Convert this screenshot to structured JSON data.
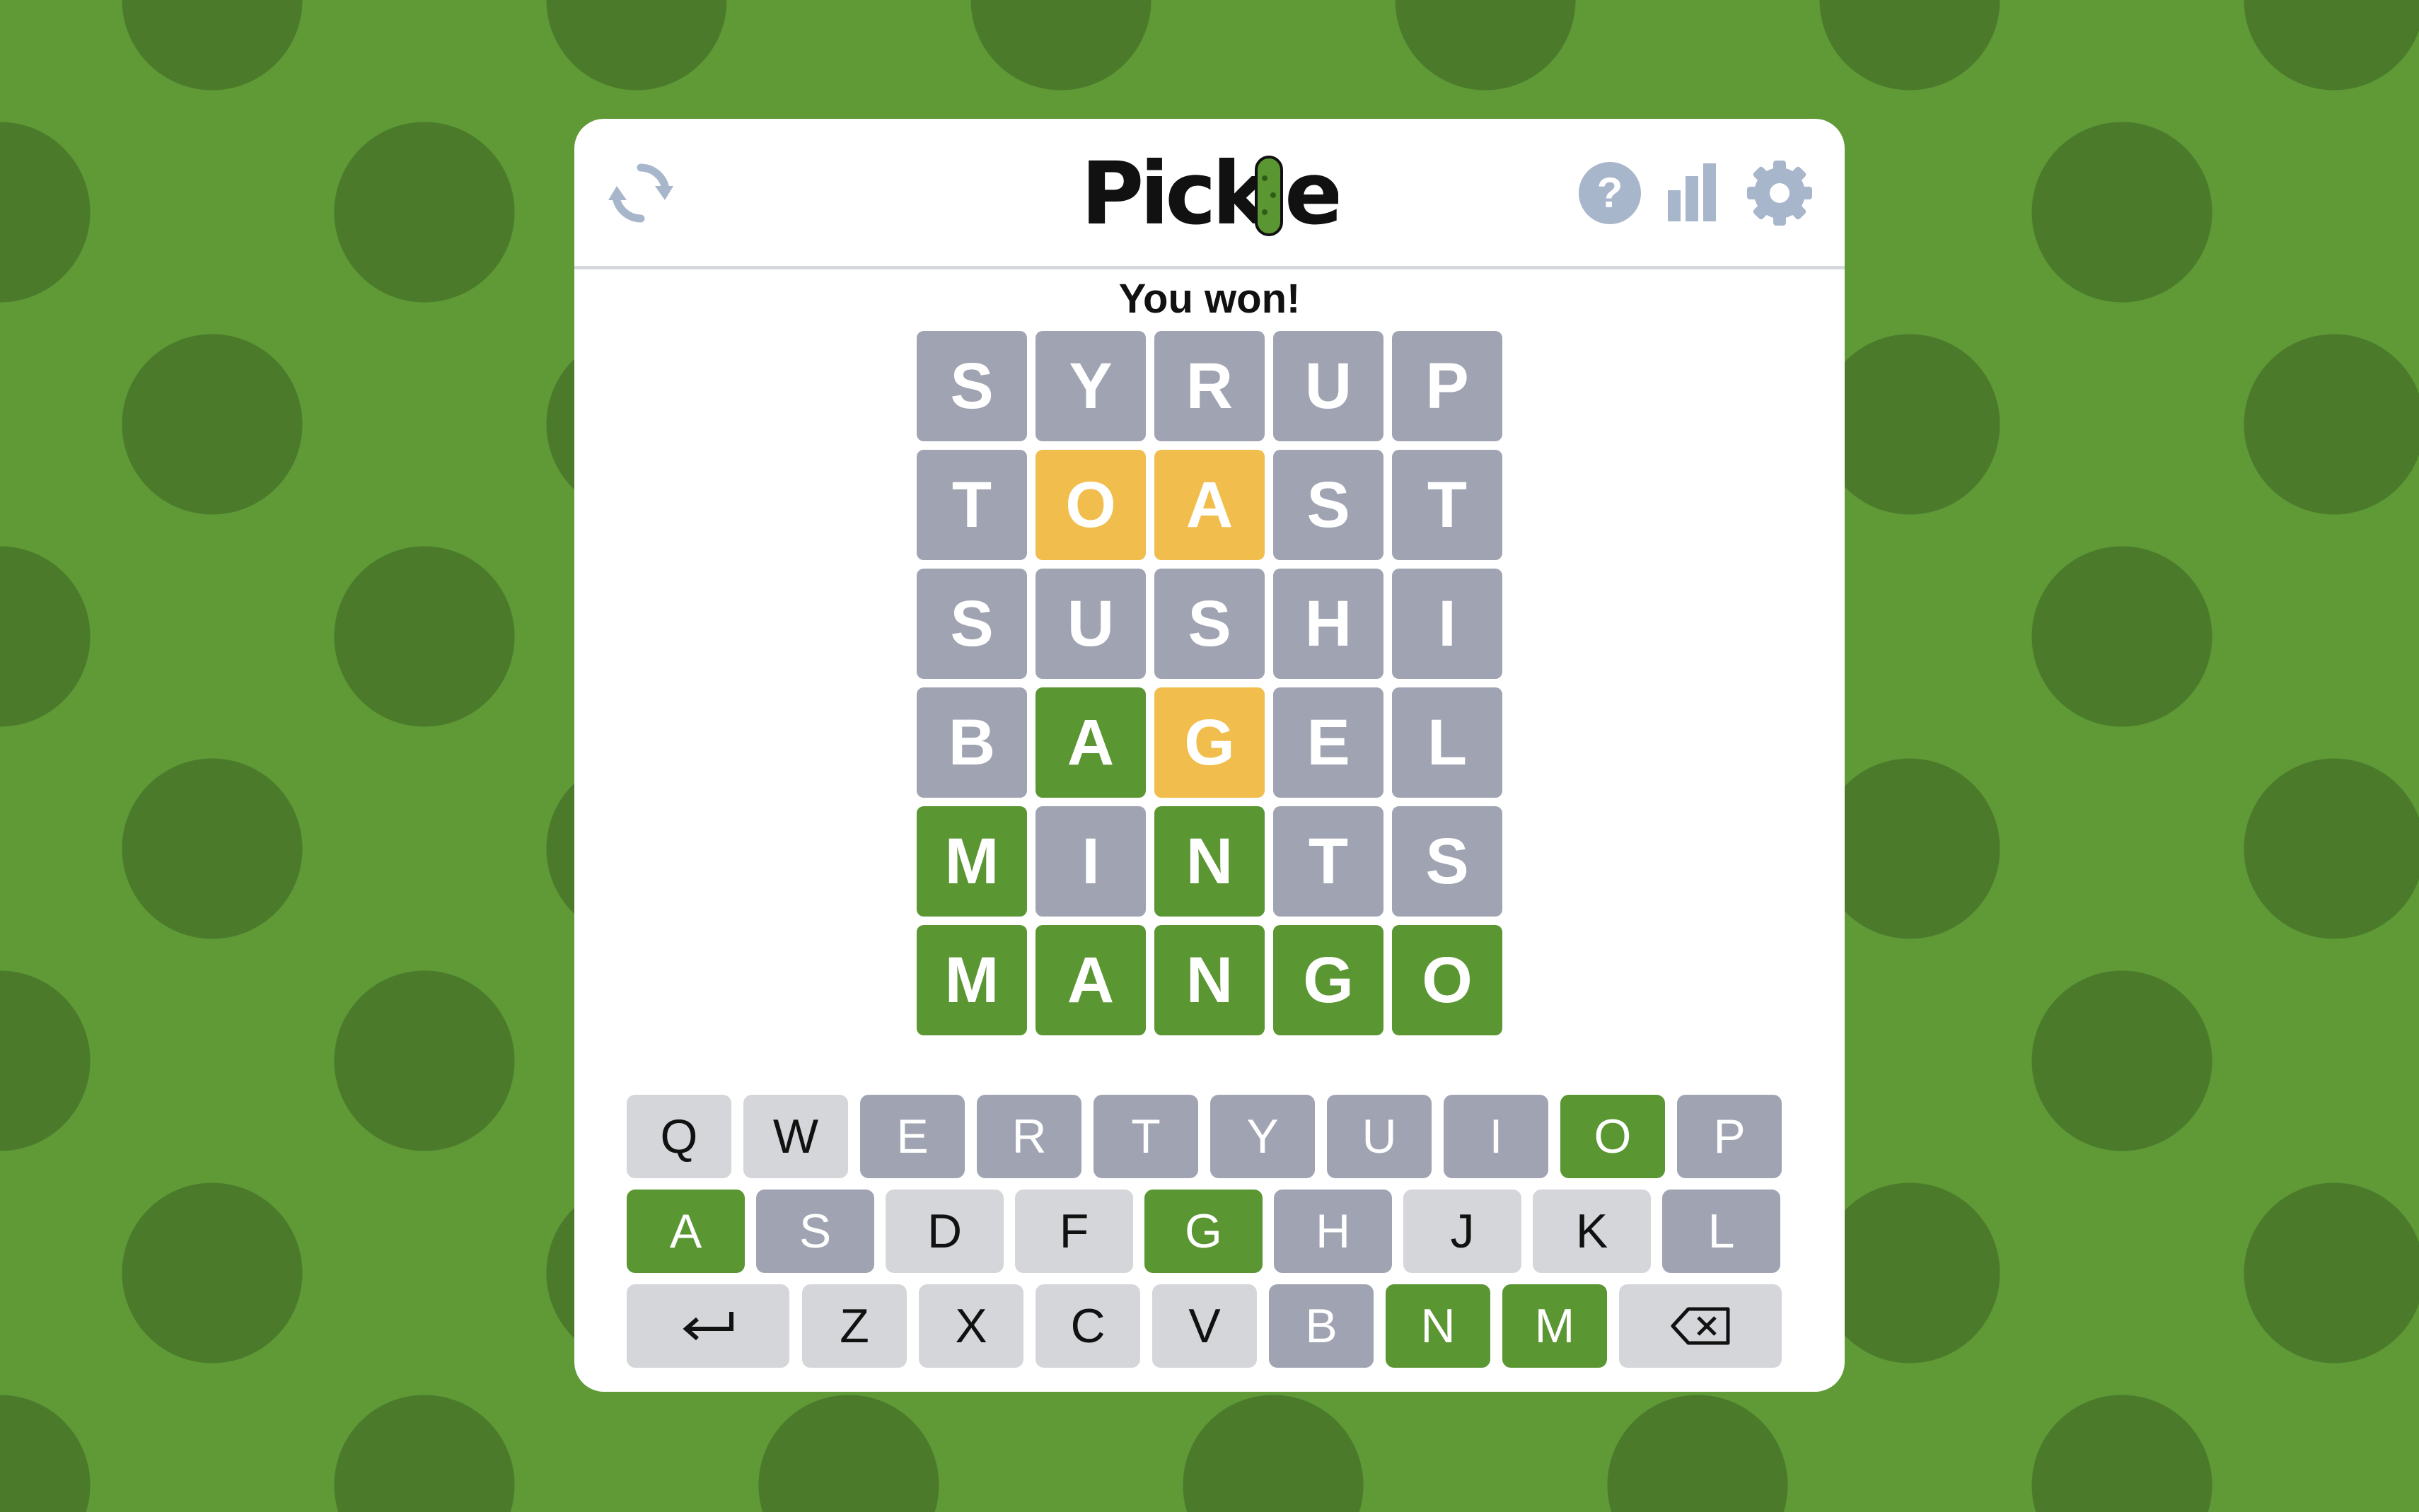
{
  "app": {
    "name": "Pickle",
    "status": "You won!"
  },
  "colors": {
    "background": "#5f9a37",
    "dots": "#4a7a2a",
    "correct": "#5a9632",
    "present": "#f1be4d",
    "absent": "#a0a4b2",
    "unused": "#d4d6da",
    "icons": "#a8b6cc"
  },
  "header": {
    "left_icon": "refresh-icon",
    "right_icons": [
      "help-icon",
      "stats-icon",
      "settings-icon"
    ]
  },
  "board": [
    [
      {
        "l": "S",
        "s": "absent"
      },
      {
        "l": "Y",
        "s": "absent"
      },
      {
        "l": "R",
        "s": "absent"
      },
      {
        "l": "U",
        "s": "absent"
      },
      {
        "l": "P",
        "s": "absent"
      }
    ],
    [
      {
        "l": "T",
        "s": "absent"
      },
      {
        "l": "O",
        "s": "present"
      },
      {
        "l": "A",
        "s": "present"
      },
      {
        "l": "S",
        "s": "absent"
      },
      {
        "l": "T",
        "s": "absent"
      }
    ],
    [
      {
        "l": "S",
        "s": "absent"
      },
      {
        "l": "U",
        "s": "absent"
      },
      {
        "l": "S",
        "s": "absent"
      },
      {
        "l": "H",
        "s": "absent"
      },
      {
        "l": "I",
        "s": "absent"
      }
    ],
    [
      {
        "l": "B",
        "s": "absent"
      },
      {
        "l": "A",
        "s": "correct"
      },
      {
        "l": "G",
        "s": "present"
      },
      {
        "l": "E",
        "s": "absent"
      },
      {
        "l": "L",
        "s": "absent"
      }
    ],
    [
      {
        "l": "M",
        "s": "correct"
      },
      {
        "l": "I",
        "s": "absent"
      },
      {
        "l": "N",
        "s": "correct"
      },
      {
        "l": "T",
        "s": "absent"
      },
      {
        "l": "S",
        "s": "absent"
      }
    ],
    [
      {
        "l": "M",
        "s": "correct"
      },
      {
        "l": "A",
        "s": "correct"
      },
      {
        "l": "N",
        "s": "correct"
      },
      {
        "l": "G",
        "s": "correct"
      },
      {
        "l": "O",
        "s": "correct"
      }
    ]
  ],
  "keyboard": {
    "row1": [
      {
        "k": "Q",
        "s": "unused"
      },
      {
        "k": "W",
        "s": "unused"
      },
      {
        "k": "E",
        "s": "absent"
      },
      {
        "k": "R",
        "s": "absent"
      },
      {
        "k": "T",
        "s": "absent"
      },
      {
        "k": "Y",
        "s": "absent"
      },
      {
        "k": "U",
        "s": "absent"
      },
      {
        "k": "I",
        "s": "absent"
      },
      {
        "k": "O",
        "s": "correct"
      },
      {
        "k": "P",
        "s": "absent"
      }
    ],
    "row2": [
      {
        "k": "A",
        "s": "correct"
      },
      {
        "k": "S",
        "s": "absent"
      },
      {
        "k": "D",
        "s": "unused"
      },
      {
        "k": "F",
        "s": "unused"
      },
      {
        "k": "G",
        "s": "correct"
      },
      {
        "k": "H",
        "s": "absent"
      },
      {
        "k": "J",
        "s": "unused"
      },
      {
        "k": "K",
        "s": "unused"
      },
      {
        "k": "L",
        "s": "absent"
      }
    ],
    "row3": [
      {
        "k": "enter",
        "s": "unused",
        "icon": "enter-icon"
      },
      {
        "k": "Z",
        "s": "unused"
      },
      {
        "k": "X",
        "s": "unused"
      },
      {
        "k": "C",
        "s": "unused"
      },
      {
        "k": "V",
        "s": "unused"
      },
      {
        "k": "B",
        "s": "absent"
      },
      {
        "k": "N",
        "s": "correct"
      },
      {
        "k": "M",
        "s": "correct"
      },
      {
        "k": "backspace",
        "s": "unused",
        "icon": "backspace-icon"
      }
    ]
  }
}
